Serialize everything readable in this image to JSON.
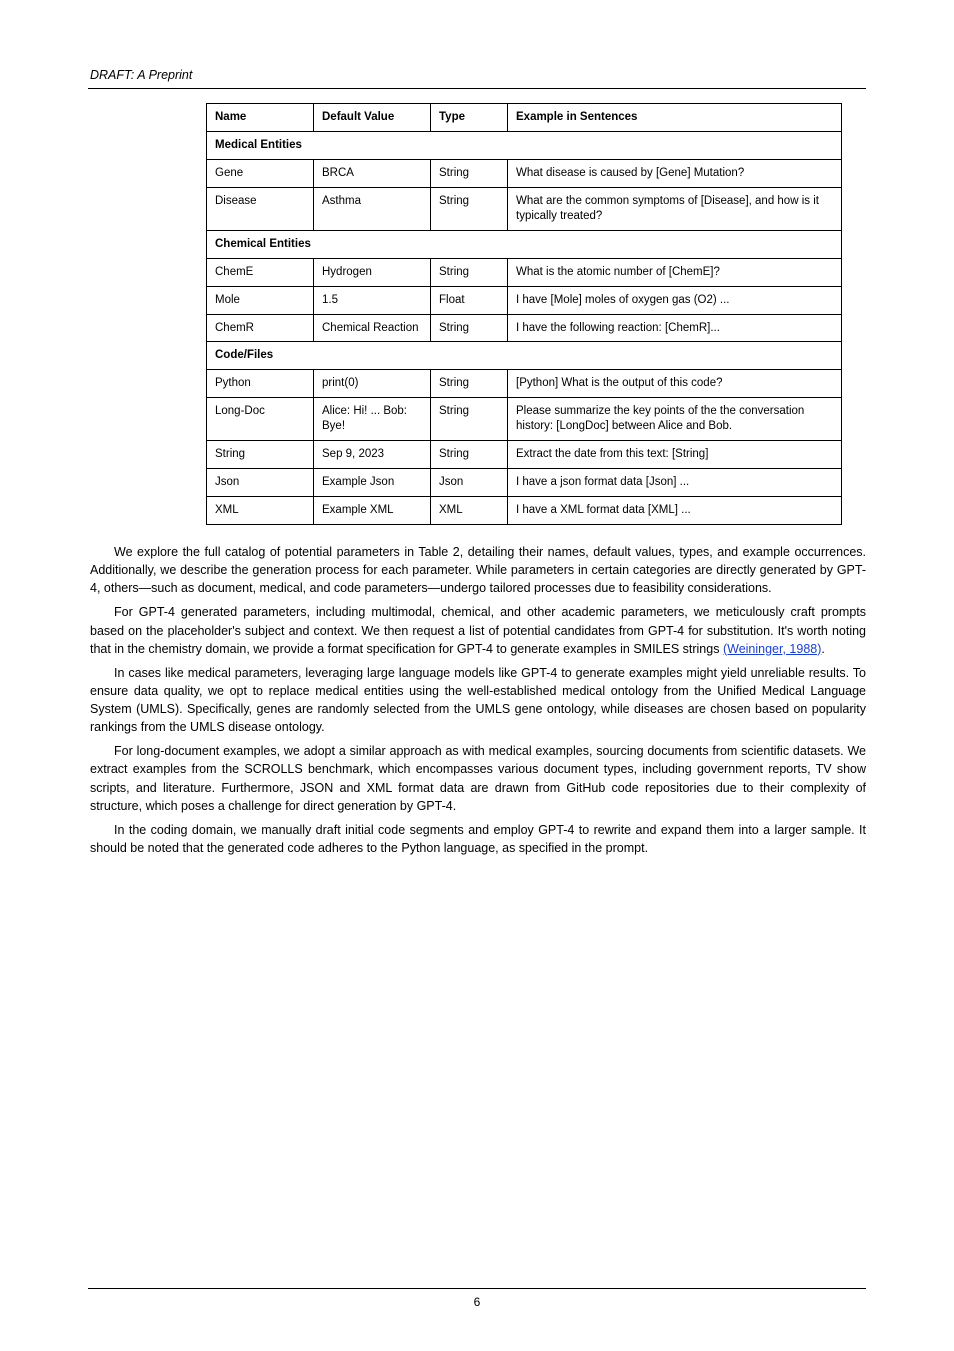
{
  "header": {
    "running_title": "DRAFT: A Preprint"
  },
  "table": {
    "header": {
      "c0": "Name",
      "c1": "Default Value",
      "c2": "Type",
      "c3": "Example in Sentences"
    },
    "section1": {
      "label": "Medical Entities"
    },
    "rows1": [
      {
        "c0": "Gene",
        "c1": "BRCA",
        "c2": "String",
        "c3": "What disease is caused by [Gene] Mutation?"
      },
      {
        "c0": "Disease",
        "c1": "Asthma",
        "c2": "String",
        "c3": "What are the common symptoms of [Disease], and how is it typically treated?"
      }
    ],
    "section2": {
      "label": "Chemical Entities"
    },
    "rows2": [
      {
        "c0": "ChemE",
        "c1": "Hydrogen",
        "c2": "String",
        "c3": "What is the atomic number of [ChemE]?"
      },
      {
        "c0": "Mole",
        "c1": "1.5",
        "c2": "Float",
        "c3": "I have [Mole] moles of oxygen gas (O2) ..."
      },
      {
        "c0": "ChemR",
        "c1": "Chemical Reaction",
        "c2": "String",
        "c3": "I have the following reaction: [ChemR]..."
      }
    ],
    "section3": {
      "label": "Code/Files"
    },
    "rows3": [
      {
        "c0": "Python",
        "c1": "print(0)",
        "c2": "String",
        "c3": "[Python] What is the output of this code?"
      },
      {
        "c0": "Long-Doc",
        "c1": "Alice: Hi! ... Bob: Bye!",
        "c2": "String",
        "c3": "Please summarize the key points of the the conversation history: [LongDoc] between Alice and Bob."
      },
      {
        "c0": "String",
        "c1": "Sep 9, 2023",
        "c2": "String",
        "c3": "Extract the date from this text: [String]"
      },
      {
        "c0": "Json",
        "c1": "Example Json",
        "c2": "Json",
        "c3": "I have a json format data [Json] ..."
      },
      {
        "c0": "XML",
        "c1": "Example XML",
        "c2": "XML",
        "c3": "I have a XML format data [XML] ..."
      }
    ]
  },
  "body": {
    "p1": "We explore the full catalog of potential parameters in Table 2, detailing their names, default values, types, and example occurrences. Additionally, we describe the generation process for each parameter. While parameters in certain categories are directly generated by GPT-4, others—such as document, medical, and code parameters—undergo tailored processes due to feasibility considerations.",
    "p2_part1": "For GPT-4 generated parameters, including multimodal, chemical, and other academic parameters, we meticulously craft prompts based on the placeholder's subject and context. We then request a list of potential candidates from GPT-4 for substitution. It's worth noting that in the chemistry domain, we provide a format specification for GPT-4 to generate examples in SMILES strings",
    "p2_link_text": "(Weininger, 1988)",
    "p2_part2": ".",
    "p3": "In cases like medical parameters, leveraging large language models like GPT-4 to generate examples might yield unreliable results. To ensure data quality, we opt to replace medical entities using the well-established medical ontology from the Unified Medical Language System (UMLS). Specifically, genes are randomly selected from the UMLS gene ontology, while diseases are chosen based on popularity rankings from the UMLS disease ontology.",
    "p4": "For long-document examples, we adopt a similar approach as with medical examples, sourcing documents from scientific datasets. We extract examples from the SCROLLS benchmark, which encompasses various document types, including government reports, TV show scripts, and literature. Furthermore, JSON and XML format data are drawn from GitHub code repositories due to their complexity of structure, which poses a challenge for direct generation by GPT-4.",
    "p5": "In the coding domain, we manually draft initial code segments and employ GPT-4 to rewrite and expand them into a larger sample. It should be noted that the generated code adheres to the Python language, as specified in the prompt."
  },
  "footer": {
    "page_number": "6"
  }
}
